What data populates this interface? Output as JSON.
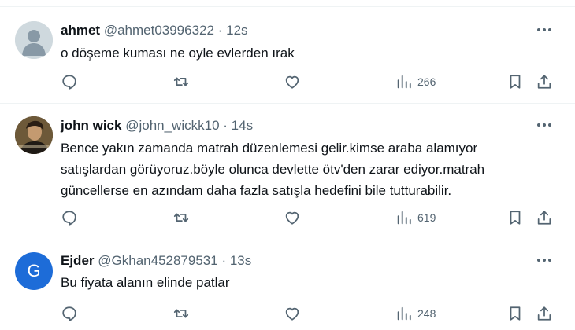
{
  "tweets": [
    {
      "name": "ahmet",
      "handle": "@ahmet03996322",
      "dot": "·",
      "time": "12s",
      "text": "o döşeme kuması ne oyle evlerden ırak",
      "views": "266",
      "avatar": {
        "type": "default",
        "letter": ""
      }
    },
    {
      "name": "john wick",
      "handle": "@john_wickk10",
      "dot": "·",
      "time": "14s",
      "text": "Bence yakın zamanda matrah düzenlemesi gelir.kimse araba alamıyor satışlardan görüyoruz.böyle olunca devlette ötv'den zarar ediyor.matrah güncellerse en azındam daha fazla satışla hedefini bile tutturabilir.",
      "views": "619",
      "avatar": {
        "type": "photo",
        "letter": ""
      }
    },
    {
      "name": "Ejder",
      "handle": "@Gkhan452879531",
      "dot": "·",
      "time": "13s",
      "text": "Bu fiyata alanın elinde patlar",
      "views": "248",
      "avatar": {
        "type": "letter",
        "letter": "G",
        "color": "#1d6cd8"
      }
    }
  ],
  "icons": {
    "reply": "reply-icon",
    "retweet": "retweet-icon",
    "like": "like-icon",
    "views": "views-icon",
    "bookmark": "bookmark-icon",
    "share": "share-icon",
    "more": "more-icon"
  },
  "colors": {
    "text": "#0f1419",
    "secondary": "#536471",
    "divider": "#eff3f4",
    "avatar_letter_bg": "#1d6cd8"
  }
}
